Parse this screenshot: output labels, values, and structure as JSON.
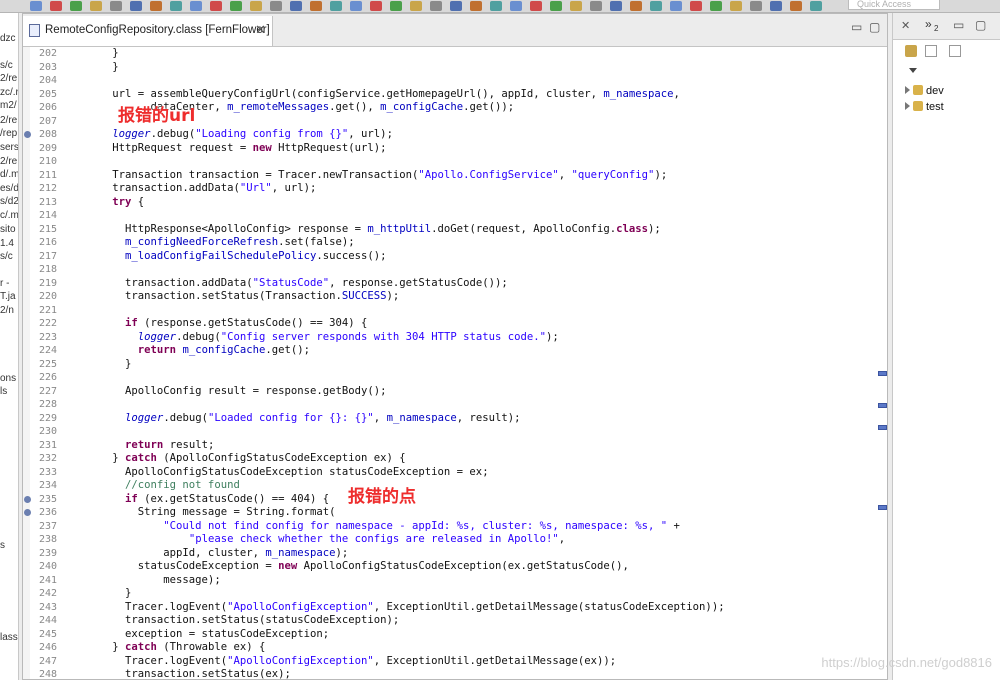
{
  "editor": {
    "tab_title": "RemoteConfigRepository.class [FernFlower]",
    "tab_close": "✕",
    "minimize": "▭",
    "maximize": "▢"
  },
  "toolbar": {
    "quick_access_placeholder": "Quick Access"
  },
  "left_pane": {
    "fragments": [
      "dzc",
      "s/c",
      "2/re",
      "zc/.r",
      "m2/",
      "2/re",
      "/rep",
      "sers",
      "2/re",
      "d/.m",
      "es/d",
      "s/d2",
      "c/.m",
      "sito",
      "1.4",
      "s/c",
      "r -",
      "T.ja",
      "2/n",
      "ons",
      "ls",
      "s",
      "lass"
    ]
  },
  "right_pane": {
    "tab_overflow": "»",
    "overflow_count": "2",
    "tree": [
      {
        "label": "dev"
      },
      {
        "label": "test"
      }
    ]
  },
  "annotations": {
    "url_error": "报错的url",
    "error_point": "报错的点"
  },
  "watermark": "https://blog.csdn.net/god8816",
  "code_lines": [
    {
      "n": "202",
      "t": "      }"
    },
    {
      "n": "203",
      "t": "      }"
    },
    {
      "n": "204",
      "t": ""
    },
    {
      "n": "205",
      "t": "      url = assembleQueryConfigUrl(configService.getHomepageUrl(), appId, cluster, m_namespace,"
    },
    {
      "n": "206",
      "t": "            dataCenter, m_remoteMessages.get(), m_configCache.get());"
    },
    {
      "n": "207",
      "t": ""
    },
    {
      "n": "208",
      "t": "      logger.debug(\"Loading config from {}\", url);"
    },
    {
      "n": "209",
      "t": "      HttpRequest request = new HttpRequest(url);"
    },
    {
      "n": "210",
      "t": ""
    },
    {
      "n": "211",
      "t": "      Transaction transaction = Tracer.newTransaction(\"Apollo.ConfigService\", \"queryConfig\");"
    },
    {
      "n": "212",
      "t": "      transaction.addData(\"Url\", url);"
    },
    {
      "n": "213",
      "t": "      try {"
    },
    {
      "n": "214",
      "t": ""
    },
    {
      "n": "215",
      "t": "        HttpResponse<ApolloConfig> response = m_httpUtil.doGet(request, ApolloConfig.class);"
    },
    {
      "n": "216",
      "t": "        m_configNeedForceRefresh.set(false);"
    },
    {
      "n": "217",
      "t": "        m_loadConfigFailSchedulePolicy.success();"
    },
    {
      "n": "218",
      "t": ""
    },
    {
      "n": "219",
      "t": "        transaction.addData(\"StatusCode\", response.getStatusCode());"
    },
    {
      "n": "220",
      "t": "        transaction.setStatus(Transaction.SUCCESS);"
    },
    {
      "n": "221",
      "t": ""
    },
    {
      "n": "222",
      "t": "        if (response.getStatusCode() == 304) {"
    },
    {
      "n": "223",
      "t": "          logger.debug(\"Config server responds with 304 HTTP status code.\");"
    },
    {
      "n": "224",
      "t": "          return m_configCache.get();"
    },
    {
      "n": "225",
      "t": "        }"
    },
    {
      "n": "226",
      "t": ""
    },
    {
      "n": "227",
      "t": "        ApolloConfig result = response.getBody();"
    },
    {
      "n": "228",
      "t": ""
    },
    {
      "n": "229",
      "t": "        logger.debug(\"Loaded config for {}: {}\", m_namespace, result);"
    },
    {
      "n": "230",
      "t": ""
    },
    {
      "n": "231",
      "t": "        return result;"
    },
    {
      "n": "232",
      "t": "      } catch (ApolloConfigStatusCodeException ex) {"
    },
    {
      "n": "233",
      "t": "        ApolloConfigStatusCodeException statusCodeException = ex;"
    },
    {
      "n": "234",
      "t": "        //config not found"
    },
    {
      "n": "235",
      "t": "        if (ex.getStatusCode() == 404) {"
    },
    {
      "n": "236",
      "t": "          String message = String.format("
    },
    {
      "n": "237",
      "t": "              \"Could not find config for namespace - appId: %s, cluster: %s, namespace: %s, \" +"
    },
    {
      "n": "238",
      "t": "                  \"please check whether the configs are released in Apollo!\","
    },
    {
      "n": "239",
      "t": "              appId, cluster, m_namespace);"
    },
    {
      "n": "240",
      "t": "          statusCodeException = new ApolloConfigStatusCodeException(ex.getStatusCode(),"
    },
    {
      "n": "241",
      "t": "              message);"
    },
    {
      "n": "242",
      "t": "        }"
    },
    {
      "n": "243",
      "t": "        Tracer.logEvent(\"ApolloConfigException\", ExceptionUtil.getDetailMessage(statusCodeException));"
    },
    {
      "n": "244",
      "t": "        transaction.setStatus(statusCodeException);"
    },
    {
      "n": "245",
      "t": "        exception = statusCodeException;"
    },
    {
      "n": "246",
      "t": "      } catch (Throwable ex) {"
    },
    {
      "n": "247",
      "t": "        Tracer.logEvent(\"ApolloConfigException\", ExceptionUtil.getDetailMessage(ex));"
    },
    {
      "n": "248",
      "t": "        transaction.setStatus(ex);"
    }
  ],
  "colors": {
    "annotation": "#ee2d2d",
    "string": "#2a00ff",
    "keyword": "#7f0055",
    "field": "#0000c0",
    "comment": "#3f7f5f"
  }
}
